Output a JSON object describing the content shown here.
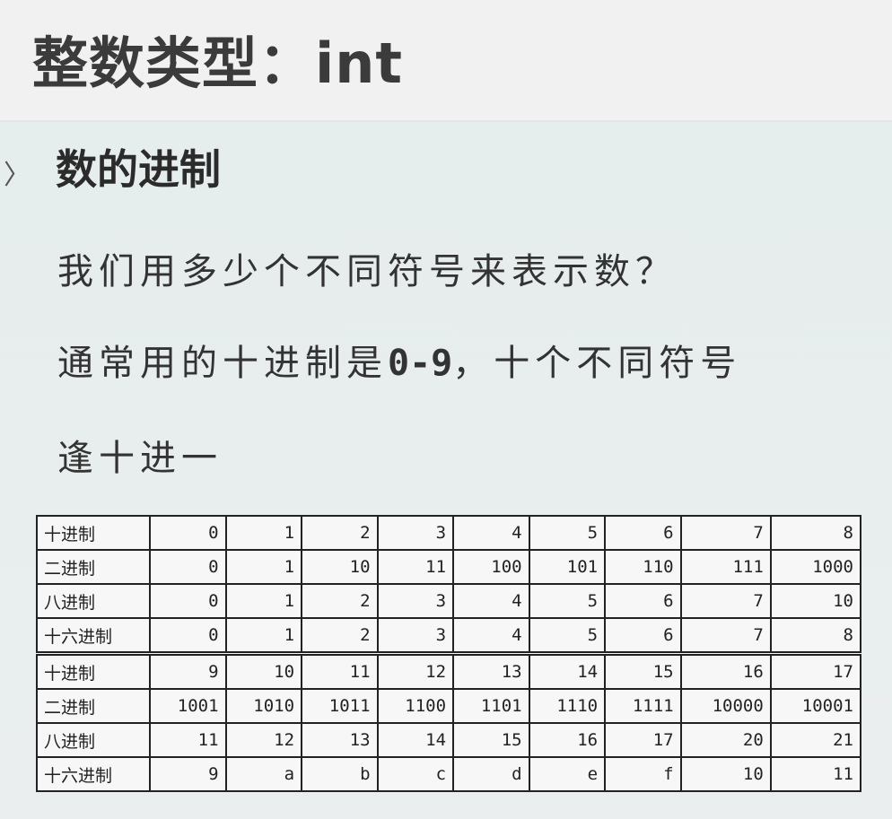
{
  "title": "整数类型：int",
  "section": {
    "chevron": "〉",
    "heading": "数的进制"
  },
  "lines": [
    {
      "pre": "我们用多少个不同符号来表示数？",
      "bold": "",
      "post": ""
    },
    {
      "pre": "通常用的十进制是",
      "bold": "0-9",
      "post": "，十个不同符号"
    },
    {
      "pre": "逢十进一",
      "bold": "",
      "post": ""
    }
  ],
  "table": {
    "rows": [
      {
        "label": "十进制",
        "cells": [
          "0",
          "1",
          "2",
          "3",
          "4",
          "5",
          "6",
          "7",
          "8"
        ]
      },
      {
        "label": "二进制",
        "cells": [
          "0",
          "1",
          "10",
          "11",
          "100",
          "101",
          "110",
          "111",
          "1000"
        ]
      },
      {
        "label": "八进制",
        "cells": [
          "0",
          "1",
          "2",
          "3",
          "4",
          "5",
          "6",
          "7",
          "10"
        ]
      },
      {
        "label": "十六进制",
        "cells": [
          "0",
          "1",
          "2",
          "3",
          "4",
          "5",
          "6",
          "7",
          "8"
        ]
      },
      {
        "label": "十进制",
        "cells": [
          "9",
          "10",
          "11",
          "12",
          "13",
          "14",
          "15",
          "16",
          "17"
        ]
      },
      {
        "label": "二进制",
        "cells": [
          "1001",
          "1010",
          "1011",
          "1100",
          "1101",
          "1110",
          "1111",
          "10000",
          "10001"
        ]
      },
      {
        "label": "八进制",
        "cells": [
          "11",
          "12",
          "13",
          "14",
          "15",
          "16",
          "17",
          "20",
          "21"
        ]
      },
      {
        "label": "十六进制",
        "cells": [
          "9",
          "a",
          "b",
          "c",
          "d",
          "e",
          "f",
          "10",
          "11"
        ]
      }
    ]
  }
}
